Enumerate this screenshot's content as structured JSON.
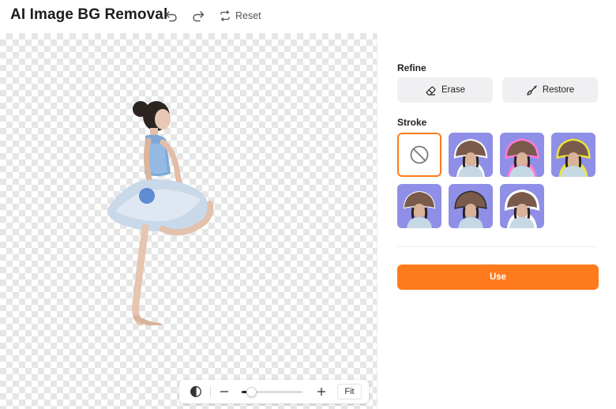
{
  "header": {
    "title": "AI Image BG Removal",
    "undo_icon": "undo-icon",
    "redo_icon": "redo-icon",
    "reset_icon": "reset-icon",
    "reset_label": "Reset"
  },
  "canvas": {
    "subject": "ballerina cutout on transparent background"
  },
  "toolbar": {
    "compare_icon": "compare-icon",
    "zoom_out_icon": "minus-icon",
    "zoom_in_icon": "plus-icon",
    "zoom_level": 0.16,
    "fit_label": "Fit"
  },
  "panel": {
    "refine_title": "Refine",
    "erase_label": "Erase",
    "erase_icon": "eraser-icon",
    "restore_label": "Restore",
    "restore_icon": "brush-icon",
    "stroke_title": "Stroke",
    "stroke_options": [
      {
        "style": "none",
        "icon": "no-stroke-icon",
        "selected": true
      },
      {
        "style": "white",
        "outline": "#ffffff",
        "selected": false
      },
      {
        "style": "pink glow",
        "outline": "#ff7ad9",
        "selected": false
      },
      {
        "style": "yellow glow",
        "outline": "#e7e43a",
        "selected": false
      },
      {
        "style": "white thin",
        "outline": "#ffffff",
        "selected": false
      },
      {
        "style": "dark",
        "outline": "#2b2b2b",
        "selected": false
      },
      {
        "style": "white thick",
        "outline": "#ffffff",
        "selected": false
      }
    ],
    "use_label": "Use"
  },
  "colors": {
    "accent": "#ff7a1c",
    "thumb_bg": "#8f8fe8"
  }
}
